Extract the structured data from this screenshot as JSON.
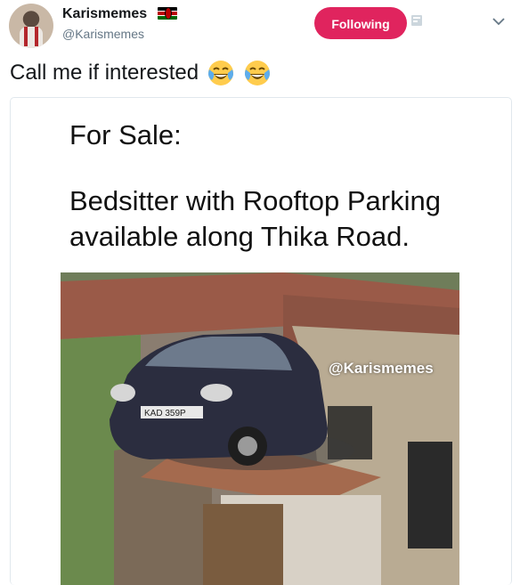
{
  "account": {
    "name": "Karismemes",
    "handle": "@Karismemes",
    "follow_label": "Following"
  },
  "tweet": {
    "text": "Call me if interested",
    "emojis": [
      "face-with-tears-of-joy",
      "face-with-tears-of-joy"
    ]
  },
  "media": {
    "heading": "For Sale:",
    "description": "Bedsitter with Rooftop Parking available along Thika Road.",
    "watermark": "@Karismemes",
    "plate": "KAD 359P"
  },
  "colors": {
    "follow_button": "#e0245e",
    "handle_text": "#657786",
    "car_body": "#2b2d3f"
  },
  "icons": [
    "kenya-flag-icon",
    "translate-icon",
    "chevron-down-icon"
  ]
}
